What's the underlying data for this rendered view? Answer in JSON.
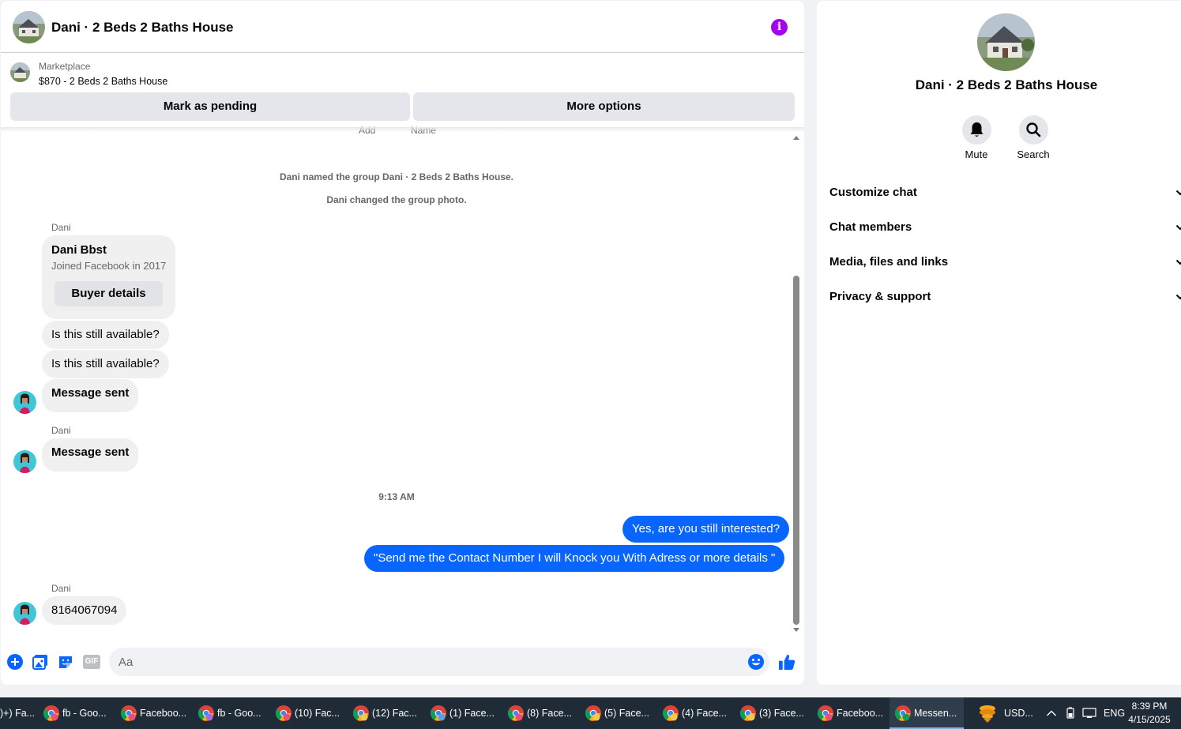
{
  "header": {
    "title": "Dani · 2 Beds 2 Baths House",
    "info_icon": "i"
  },
  "marketplace": {
    "label": "Marketplace",
    "listing": "$870 - 2 Beds 2 Baths House",
    "mark_pending": "Mark as pending",
    "more_options": "More options"
  },
  "cut_off": {
    "left": "Add",
    "right": "Name"
  },
  "messages": {
    "system_1": "Dani named the group Dani · 2 Beds 2 Baths House.",
    "system_2": "Dani changed the group photo.",
    "sender_1": "Dani",
    "card_name": "Dani Bbst",
    "card_sub": "Joined Facebook in 2017",
    "card_button": "Buyer details",
    "msg_1": "Is this still available?",
    "msg_2": "Is this still available?",
    "msg_3": "Message sent",
    "sender_2": "Dani",
    "msg_4": "Message sent",
    "time": "9:13 AM",
    "out_1": "Yes, are you still interested?",
    "out_2": "\"Send me the Contact Number I will Knock you With Adress or more details \"",
    "sender_3": "Dani",
    "msg_5": "8164067094"
  },
  "composer": {
    "placeholder": "Aa",
    "gif_label": "GIF"
  },
  "info_panel": {
    "title": "Dani · 2 Beds 2 Baths House",
    "mute": "Mute",
    "search": "Search",
    "sections": [
      "Customize chat",
      "Chat members",
      "Media, files and links",
      "Privacy & support"
    ]
  },
  "taskbar": {
    "items": [
      ")+) Fa...",
      "fb - Goo...",
      "Faceboo...",
      "fb - Goo...",
      "(10) Fac...",
      "(12) Fac...",
      "(1) Face...",
      "(8) Face...",
      "(5) Face...",
      "(4) Face...",
      "(3) Face...",
      "Faceboo...",
      "Messen..."
    ],
    "tray_currency": "USD...",
    "tray_lang": "ENG",
    "time": "8:39 PM",
    "date": "4/15/2025"
  },
  "colors": {
    "accent": "#0866ff",
    "info": "#a305ec",
    "bubble_in": "#f0f0f0",
    "taskbar": "#202b38"
  }
}
